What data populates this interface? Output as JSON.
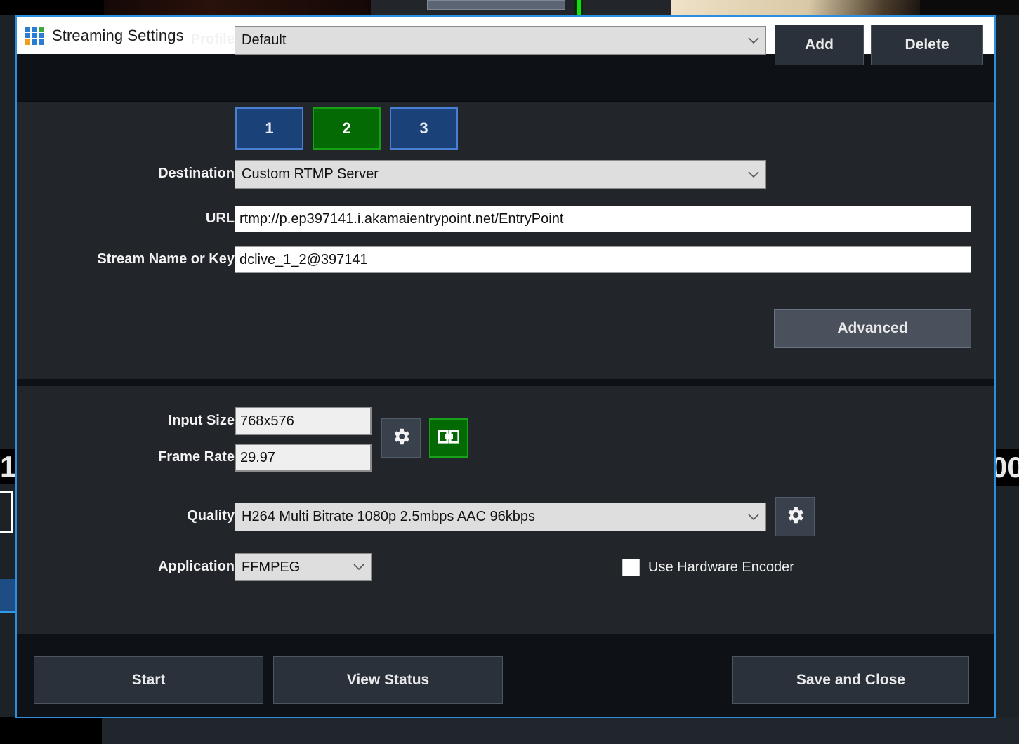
{
  "window": {
    "title": "Streaming Settings",
    "icon": "app-grid-icon",
    "controls": {
      "minimize": "minimize-icon",
      "maximize": "maximize-icon",
      "close": "close-icon"
    },
    "accent_border": "#2a8fe0"
  },
  "profile": {
    "label": "Profile",
    "value": "Default",
    "add_label": "Add",
    "delete_label": "Delete"
  },
  "channels": {
    "items": [
      {
        "label": "1",
        "active": false
      },
      {
        "label": "2",
        "active": true
      },
      {
        "label": "3",
        "active": false
      }
    ],
    "active_color": "#046b04",
    "inactive_color": "#1b4179"
  },
  "stream": {
    "destination_label": "Destination",
    "destination_value": "Custom RTMP Server",
    "url_label": "URL",
    "url_value": "rtmp://p.ep397141.i.akamaientrypoint.net/EntryPoint",
    "key_label": "Stream Name or Key",
    "key_value": "dclive_1_2@397141",
    "advanced_label": "Advanced"
  },
  "encoding": {
    "input_size_label": "Input Size",
    "input_size_value": "768x576",
    "frame_rate_label": "Frame Rate",
    "frame_rate_value": "29.97",
    "video_settings_icon": "gear-icon",
    "link_icon": "link-icon",
    "quality_label": "Quality",
    "quality_value": "H264 Multi Bitrate 1080p 2.5mbps AAC 96kbps",
    "quality_settings_icon": "gear-icon",
    "application_label": "Application",
    "application_value": "FFMPEG",
    "hardware_encoder_label": "Use Hardware Encoder",
    "hardware_encoder_checked": false
  },
  "footer": {
    "start_label": "Start",
    "view_status_label": "View Status",
    "save_close_label": "Save and Close"
  },
  "backdrop": {
    "left_number": "1",
    "right_number": "00"
  }
}
